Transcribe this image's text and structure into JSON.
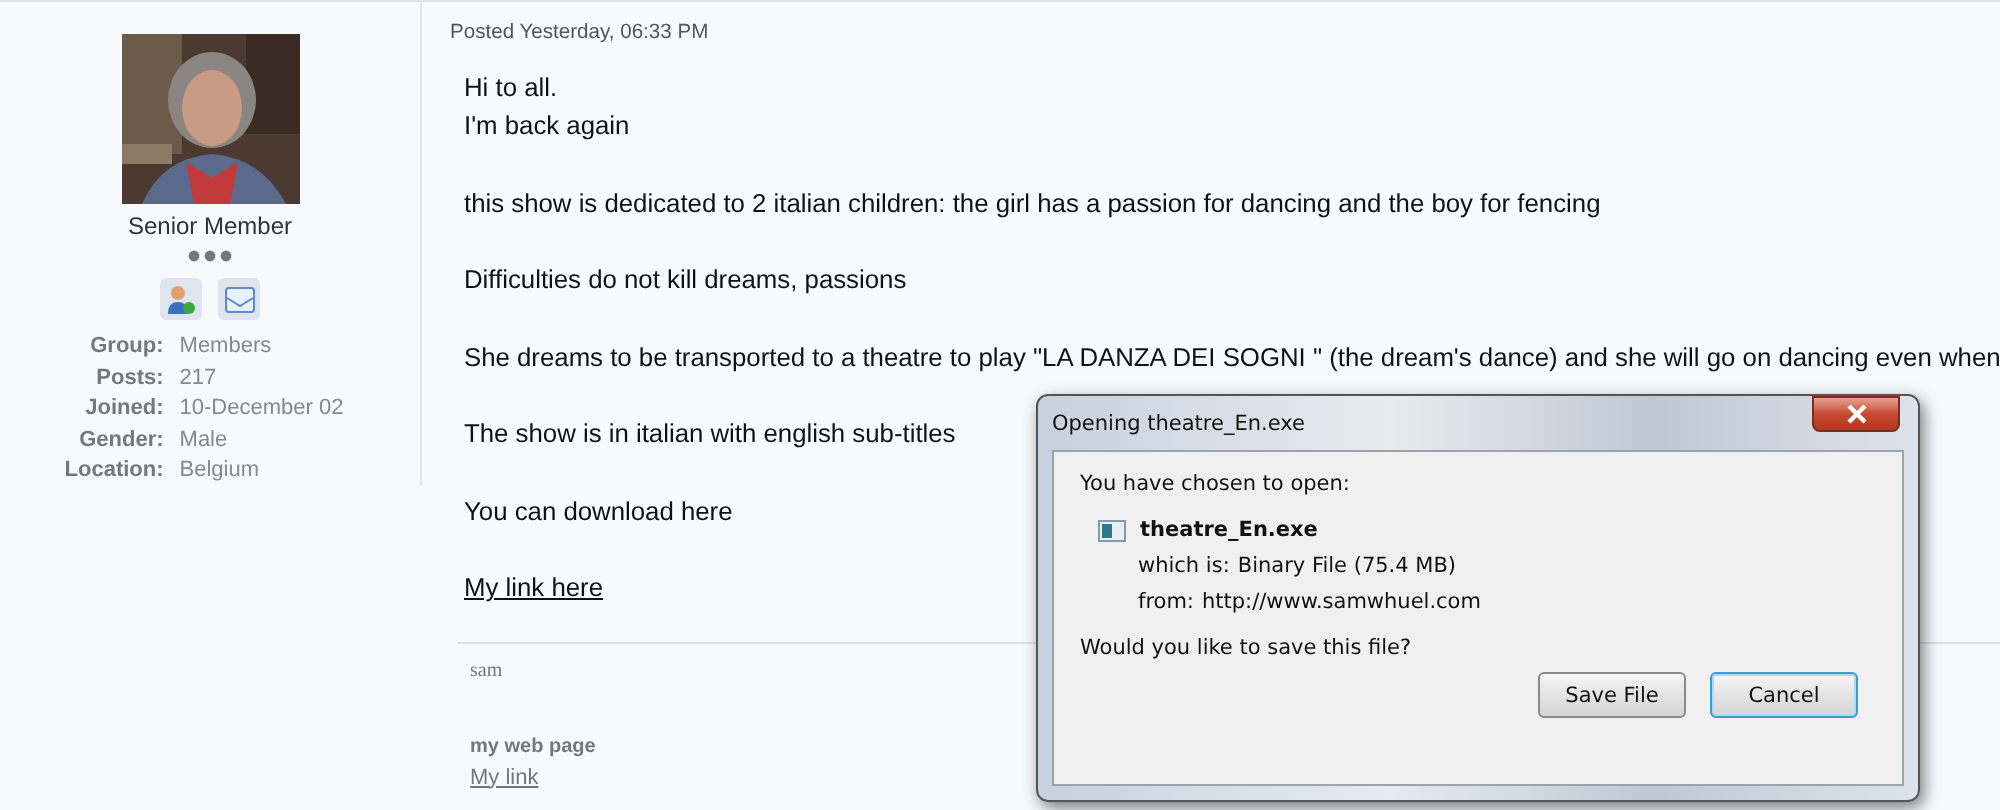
{
  "profile": {
    "rank": "Senior Member",
    "fields": [
      {
        "label": "Group:",
        "value": "Members"
      },
      {
        "label": "Posts:",
        "value": "217"
      },
      {
        "label": "Joined:",
        "value": "10-December 02"
      },
      {
        "label": "Gender:",
        "value": "Male"
      },
      {
        "label": "Location:",
        "value": "Belgium"
      }
    ]
  },
  "post": {
    "posted": "Posted Yesterday, 06:33 PM",
    "paragraphs": [
      {
        "kind": "text",
        "lines": [
          "Hi to all.",
          "I'm back again"
        ]
      },
      {
        "kind": "text",
        "lines": [
          "this show is dedicated to 2 italian children: the girl has a passion for dancing and the boy for fencing"
        ]
      },
      {
        "kind": "text",
        "lines": [
          "Difficulties do not kill dreams, passions"
        ]
      },
      {
        "kind": "text",
        "lines": [
          "She dreams to be transported to a theatre to play \"LA DANZA DEI SOGNI \" (the dream's dance) and she will go on dancing even when"
        ]
      },
      {
        "kind": "text",
        "lines": [
          "The show is in italian with english sub-titles"
        ]
      },
      {
        "kind": "text",
        "lines": [
          "You can download here"
        ]
      },
      {
        "kind": "link",
        "lines": [
          "My link here"
        ]
      }
    ],
    "signature": {
      "name": "sam",
      "heading": "my web page",
      "link": "My link"
    }
  },
  "dialog": {
    "title": "Opening theatre_En.exe",
    "prompt": "You have chosen to open:",
    "file": "theatre_En.exe",
    "type_label": "which is:",
    "type_value": "Binary File (75.4 MB)",
    "from_label": "from:",
    "from_value": "http://www.samwhuel.com",
    "question": "Would you like to save this file?",
    "buttons": [
      {
        "label": "Save File",
        "focused": false
      },
      {
        "label": "Cancel",
        "focused": true
      }
    ]
  }
}
